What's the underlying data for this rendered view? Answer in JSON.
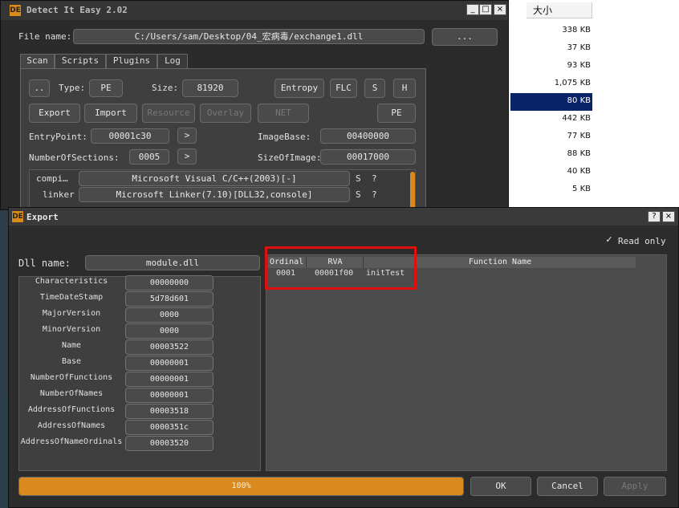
{
  "die": {
    "title": "Detect It Easy 2.02",
    "icon_text": "DE",
    "win_minimize": "_",
    "win_maximize": "□",
    "win_close": "×",
    "file_name_label": "File name:",
    "file_path": "C:/Users/sam/Desktop/04_宏病毒/exchange1.dll",
    "browse_label": "...",
    "tabs": [
      "Scan",
      "Scripts",
      "Plugins",
      "Log"
    ],
    "up_label": "..",
    "type_label": "Type:",
    "type_value": "PE",
    "size_label": "Size:",
    "size_value": "81920",
    "entropy_label": "Entropy",
    "flc_label": "FLC",
    "s_label": "S",
    "h_label": "H",
    "export_label": "Export",
    "import_label": "Import",
    "resource_label": "Resource",
    "overlay_label": "Overlay",
    "net_label": "NET",
    "pe_label": "PE",
    "entrypoint_label": "EntryPoint:",
    "entrypoint_value": "00001c30",
    "imagebase_label": "ImageBase:",
    "imagebase_value": "00400000",
    "sections_label": "NumberOfSections:",
    "sections_value": "0005",
    "sizeofimage_label": "SizeOfImage:",
    "sizeofimage_value": "00017000",
    "arrow": ">",
    "results": [
      {
        "kind": "compi…",
        "value": "Microsoft Visual C/C++(2003)[-]",
        "s": "S",
        "q": "?"
      },
      {
        "kind": "linker",
        "value": "Microsoft Linker(7.10)[DLL32,console]",
        "s": "S",
        "q": "?"
      }
    ]
  },
  "explorer": {
    "column_header": "大小",
    "sizes": [
      "338 KB",
      "37 KB",
      "93 KB",
      "1,075 KB",
      "80 KB",
      "442 KB",
      "77 KB",
      "88 KB",
      "40 KB",
      "5 KB"
    ],
    "selected_index": 4
  },
  "export_dialog": {
    "title": "Export",
    "help_btn": "?",
    "close_btn": "×",
    "read_only_label": "Read only",
    "read_only_check": "✓",
    "dll_name_label": "Dll name:",
    "dll_name_value": "module.dll",
    "fields": [
      {
        "label": "Characteristics",
        "value": "00000000"
      },
      {
        "label": "TimeDateStamp",
        "value": "5d78d601"
      },
      {
        "label": "MajorVersion",
        "value": "0000"
      },
      {
        "label": "MinorVersion",
        "value": "0000"
      },
      {
        "label": "Name",
        "value": "00003522"
      },
      {
        "label": "Base",
        "value": "00000001"
      },
      {
        "label": "NumberOfFunctions",
        "value": "00000001"
      },
      {
        "label": "NumberOfNames",
        "value": "00000001"
      },
      {
        "label": "AddressOfFunctions",
        "value": "00003518"
      },
      {
        "label": "AddressOfNames",
        "value": "0000351c"
      },
      {
        "label": "AddressOfNameOrdinals",
        "value": "00003520"
      }
    ],
    "table_headers": [
      "Ordinal",
      "RVA",
      "Function Name"
    ],
    "table_rows": [
      {
        "ordinal": "0001",
        "rva": "00001f00",
        "name": "initTest"
      }
    ],
    "progress_text": "100%",
    "progress_value": 1.0,
    "ok_label": "OK",
    "cancel_label": "Cancel",
    "apply_label": "Apply",
    "highlight_color": "#e01010",
    "accent_color": "#d98a1e"
  }
}
